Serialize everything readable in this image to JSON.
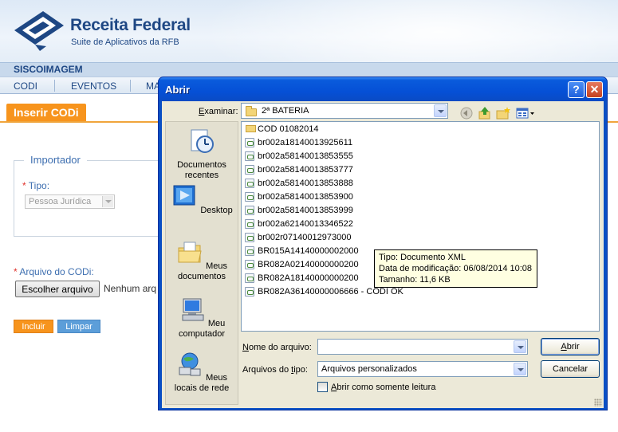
{
  "header": {
    "brand_title": "Receita Federal",
    "brand_subtitle": "Suite de Aplicativos da RFB"
  },
  "app": {
    "name": "SISCOIMAGEM"
  },
  "nav": {
    "items": [
      "CODI",
      "EVENTOS",
      "MA"
    ]
  },
  "form": {
    "section_title": "Inserir CODi",
    "fieldset_legend": "Importador",
    "required_mark": "*",
    "tipo_label": "Tipo:",
    "tipo_value": "Pessoa Jurídica",
    "arquivo_label": "Arquivo do CODi:",
    "file_button": "Escolher arquivo",
    "file_status": "Nenhum arq",
    "incluir_button": "Incluir",
    "limpar_button": "Limpar"
  },
  "dialog": {
    "title": "Abrir",
    "help_button": "?",
    "close_button": "✕",
    "look_in_label": "Examinar:",
    "look_in_value": "2ª BATERIA",
    "places": [
      {
        "label": "Documentos recentes",
        "icon": "recent-documents-icon"
      },
      {
        "label": "Desktop",
        "icon": "desktop-icon"
      },
      {
        "label": "Meus documentos",
        "icon": "my-documents-icon"
      },
      {
        "label": "Meu computador",
        "icon": "my-computer-icon"
      },
      {
        "label": "Meus locais de rede",
        "icon": "network-places-icon"
      }
    ],
    "files": [
      {
        "name": "COD 01082014",
        "type": "folder"
      },
      {
        "name": "br002a18140013925611",
        "type": "xml"
      },
      {
        "name": "br002a58140013853555",
        "type": "xml"
      },
      {
        "name": "br002a58140013853777",
        "type": "xml"
      },
      {
        "name": "br002a58140013853888",
        "type": "xml"
      },
      {
        "name": "br002a58140013853900",
        "type": "xml"
      },
      {
        "name": "br002a58140013853999",
        "type": "xml"
      },
      {
        "name": "br002a62140013346522",
        "type": "xml"
      },
      {
        "name": "br002r07140012973000",
        "type": "xml"
      },
      {
        "name": "BR015A14140000002000",
        "type": "xml"
      },
      {
        "name": "BR082A02140000000200",
        "type": "xml"
      },
      {
        "name": "BR082A18140000000200",
        "type": "xml"
      },
      {
        "name": "BR082A36140000006666 - CODI OK",
        "type": "xml"
      }
    ],
    "tooltip": {
      "line1": "Tipo: Documento XML",
      "line2": "Data de modificação: 06/08/2014 10:08",
      "line3": "Tamanho: 11,6 KB"
    },
    "filename_label": "Nome do arquivo:",
    "filename_value": "",
    "filetype_label": "Arquivos do tipo:",
    "filetype_value": "Arquivos personalizados",
    "readonly_label": "Abrir como somente leitura",
    "open_button": "Abrir",
    "cancel_button": "Cancelar"
  },
  "colors": {
    "accent_orange": "#f7941d",
    "brand_blue": "#1e4784",
    "xp_title_blue": "#0550d6"
  }
}
